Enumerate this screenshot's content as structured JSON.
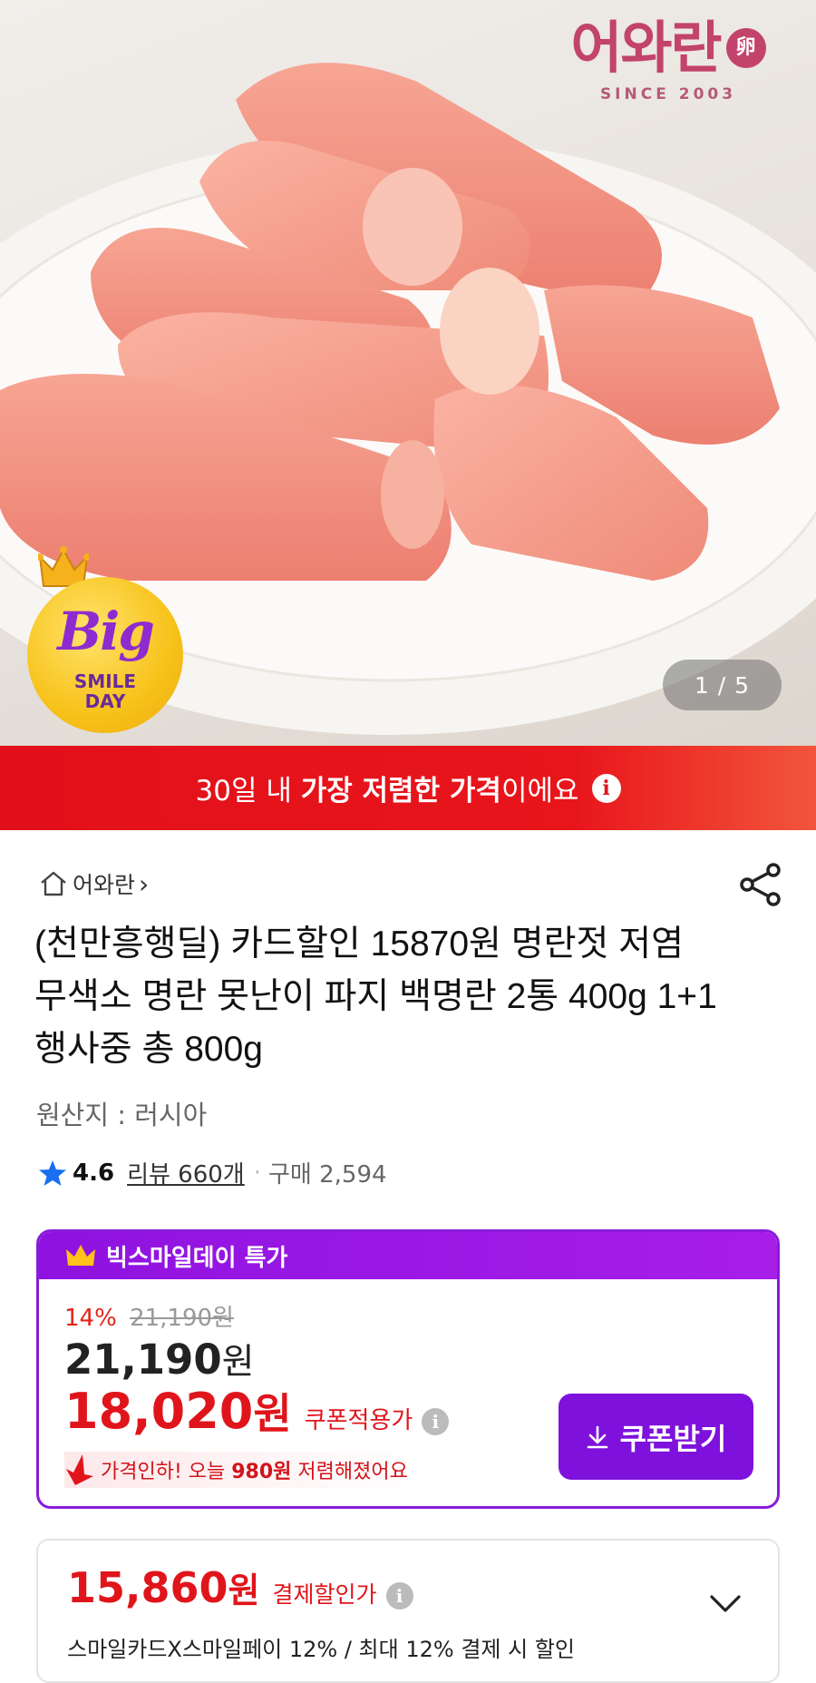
{
  "hero": {
    "brand_name": "어와란",
    "brand_seal": "卵",
    "brand_since": "SINCE 2003",
    "badge_big": "Big",
    "badge_sub_1": "SMILE",
    "badge_sub_2": "DAY",
    "image_counter": "1 / 5"
  },
  "banner": {
    "prefix": "30일 내 ",
    "emphasis": "가장 저렴한 가격",
    "suffix": "이에요",
    "info_glyph": "i"
  },
  "product": {
    "store_name": "어와란",
    "store_chevron": "›",
    "title": "(천만흥행딜) 카드할인 15870원 명란젓 저염 무색소 명란 못난이 파지 백명란 2통 400g 1+1 행사중 총 800g",
    "origin": "원산지 : 러시아",
    "rating": "4.6",
    "reviews": "리뷰 660개",
    "separator": "·",
    "purchases": "구매 2,594"
  },
  "deal": {
    "header": "빅스마일데이 특가",
    "discount_pct": "14%",
    "original_price": "21,190원",
    "price_amount": "21,190",
    "price_unit": "원",
    "coupon_amount": "18,020",
    "coupon_unit": "원",
    "coupon_label": "쿠폰적용가",
    "drop_prefix": "가격인하! 오늘 ",
    "drop_amount": "980원",
    "drop_suffix": " 저렴해졌어요",
    "coupon_button": "쿠폰받기"
  },
  "payment": {
    "amount": "15,860",
    "unit": "원",
    "label": "결제할인가",
    "description": "스마일카드X스마일페이 12% / 최대 12% 결제 시 할인"
  },
  "colors": {
    "accent_red": "#e0151b",
    "accent_purple": "#7e12dc",
    "brand_pink": "#c2436b"
  }
}
